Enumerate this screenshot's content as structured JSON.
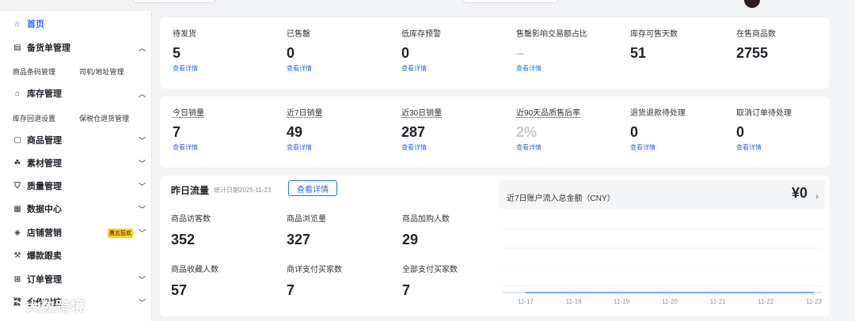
{
  "sidebar": {
    "home": "首页",
    "items": [
      {
        "label": "备货单管理",
        "icon": "clipboard-icon"
      },
      {
        "label": "库存管理",
        "icon": "warehouse-icon"
      },
      {
        "label": "商品管理",
        "icon": "box-icon"
      },
      {
        "label": "素材管理",
        "icon": "materials-icon"
      },
      {
        "label": "质量管理",
        "icon": "shield-icon"
      },
      {
        "label": "数据中心",
        "icon": "data-icon"
      },
      {
        "label": "店铺营销",
        "icon": "tag-icon"
      },
      {
        "label": "爆款跟卖",
        "icon": "hammer-icon"
      },
      {
        "label": "订单管理",
        "icon": "cart-icon"
      },
      {
        "label": "合作对接",
        "icon": "link-icon"
      }
    ],
    "sub_stock_order": [
      "商品条码管理",
      "司机/地址管理"
    ],
    "sub_inventory": [
      "库存回退设置",
      "保税仓退货管理"
    ],
    "promo_badge": "黑五狂欢"
  },
  "row1": [
    {
      "label": "待发货",
      "value": "5",
      "link": "查看详情"
    },
    {
      "label": "已售罄",
      "value": "0",
      "link": "查看详情"
    },
    {
      "label": "低库存预警",
      "value": "0",
      "link": "查看详情"
    },
    {
      "label": "售罄影响交易额占比",
      "value": "–",
      "link": "查看详情"
    },
    {
      "label": "库存可售天数",
      "value": "51",
      "link": ""
    },
    {
      "label": "在售商品数",
      "value": "2755",
      "link": ""
    }
  ],
  "row2": [
    {
      "label": "今日销量",
      "value": "7",
      "link": "查看详情"
    },
    {
      "label": "近7日销量",
      "value": "49",
      "link": "查看详情"
    },
    {
      "label": "近30日销量",
      "value": "287",
      "link": "查看详情"
    },
    {
      "label": "近90天品质售后率",
      "value": "2%",
      "link": "查看详情"
    },
    {
      "label": "退货退款待处理",
      "value": "0",
      "link": "查看详情"
    },
    {
      "label": "取消订单待处理",
      "value": "0",
      "link": "查看详情"
    }
  ],
  "flow": {
    "title": "昨日流量",
    "date": "统计日期2025-11-23",
    "button": "查看详情",
    "stats": [
      {
        "label": "商品访客数",
        "value": "352"
      },
      {
        "label": "商品浏览量",
        "value": "327"
      },
      {
        "label": "商品加购人数",
        "value": "29"
      },
      {
        "label": "商品收藏人数",
        "value": "57"
      },
      {
        "label": "商详支付买家数",
        "value": "7"
      },
      {
        "label": "全部支付买家数",
        "value": "7"
      }
    ]
  },
  "account": {
    "title": "近7日账户流入总金额（CNY）",
    "amount": "¥0"
  },
  "chart_data": {
    "type": "line",
    "categories": [
      "11-17",
      "11-18",
      "11-19",
      "11-20",
      "11-21",
      "11-22",
      "11-23"
    ],
    "series": [
      {
        "values": [
          0,
          0,
          0,
          0,
          0,
          0,
          0
        ]
      }
    ]
  },
  "watermark": "大数跨境"
}
